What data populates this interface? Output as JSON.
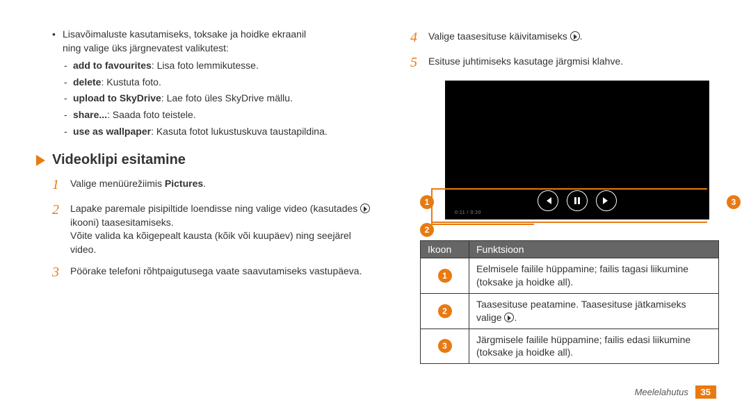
{
  "left": {
    "bullet_intro_l1": "Lisavõimaluste kasutamiseks, toksake ja hoidke ekraanil",
    "bullet_intro_l2": "ning valige üks järgnevatest valikutest:",
    "options": [
      {
        "bold": "add to favourites",
        "rest": ": Lisa foto lemmikutesse."
      },
      {
        "bold": "delete",
        "rest": ": Kustuta foto."
      },
      {
        "bold": "upload to SkyDrive",
        "rest": ": Lae foto üles SkyDrive mällu."
      },
      {
        "bold": "share...",
        "rest": ": Saada foto teistele."
      },
      {
        "bold": "use as wallpaper",
        "rest": ": Kasuta fotot lukustuskuva taustapildina."
      }
    ],
    "heading": "Videoklipi esitamine",
    "steps": {
      "s1_a": "Valige menüürežiimis ",
      "s1_b": "Pictures",
      "s1_c": ".",
      "s2_a": "Lapake paremale pisipiltide loendisse ning valige video (kasutades ",
      "s2_b": " ikooni) taasesitamiseks.",
      "s2_extra": "Võite valida ka kõigepealt kausta (kõik või kuupäev) ning seejärel video.",
      "s3": "Pöörake telefoni rõhtpaigutusega vaate saavutamiseks vastupäeva."
    }
  },
  "right": {
    "steps": {
      "s4_a": "Valige taasesituse käivitamiseks ",
      "s4_b": ".",
      "s5": "Esituse juhtimiseks kasutage järgmisi klahve."
    },
    "time_readout": "0:11  / 0:20",
    "badge": {
      "b1": "1",
      "b2": "2",
      "b3": "3"
    },
    "table": {
      "h_icon": "Ikoon",
      "h_func": "Funktsioon",
      "rows": [
        {
          "n": "1",
          "text": "Eelmisele failile hüppamine; failis tagasi liikumine (toksake ja hoidke all)."
        },
        {
          "n": "2",
          "text_a": "Taasesituse peatamine. Taasesituse jätkamiseks valige ",
          "text_b": "."
        },
        {
          "n": "3",
          "text": "Järgmisele failile hüppamine; failis edasi liikumine (toksake ja hoidke all)."
        }
      ]
    }
  },
  "footer": {
    "section": "Meelelahutus",
    "page": "35"
  }
}
